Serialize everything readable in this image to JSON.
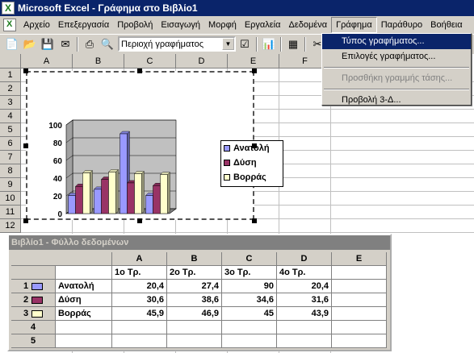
{
  "title_bar": {
    "text": "Microsoft Excel - Γράφημα στο Βιβλίο1"
  },
  "menu": [
    {
      "label": "Αρχείο",
      "open": false
    },
    {
      "label": "Επεξεργασία",
      "open": false
    },
    {
      "label": "Προβολή",
      "open": false
    },
    {
      "label": "Εισαγωγή",
      "open": false
    },
    {
      "label": "Μορφή",
      "open": false
    },
    {
      "label": "Εργαλεία",
      "open": false
    },
    {
      "label": "Δεδομένα",
      "open": false
    },
    {
      "label": "Γράφημα",
      "open": true
    },
    {
      "label": "Παράθυρο",
      "open": false
    },
    {
      "label": "Βοήθεια",
      "open": false
    }
  ],
  "toolbar": {
    "chart_object": "Περιοχή γραφήματος"
  },
  "dropdown": [
    {
      "label": "Τύπος γραφήματος...",
      "state": "selected"
    },
    {
      "label": "Επιλογές γραφήματος...",
      "state": "normal"
    },
    {
      "label": "Προσθήκη γραμμής τάσης...",
      "state": "disabled"
    },
    {
      "label": "Προβολή 3-Δ...",
      "state": "normal"
    }
  ],
  "sheet": {
    "columns": [
      "A",
      "B",
      "C",
      "D",
      "E",
      "F"
    ],
    "rows": [
      "1",
      "2",
      "3",
      "4",
      "5",
      "6",
      "7",
      "8",
      "9",
      "10",
      "11",
      "12"
    ]
  },
  "datasheet": {
    "title": "Βιβλίο1 - Φύλλο δεδομένων",
    "columns": [
      "A",
      "B",
      "C",
      "D",
      "E"
    ],
    "categories": [
      "1ο Τρ.",
      "2ο Τρ.",
      "3ο Τρ.",
      "4ο Τρ."
    ],
    "rows": [
      {
        "num": "1",
        "name": "Ανατολή",
        "values": [
          "20,4",
          "27,4",
          "90",
          "20,4"
        ]
      },
      {
        "num": "2",
        "name": "Δύση",
        "values": [
          "30,6",
          "38,6",
          "34,6",
          "31,6"
        ]
      },
      {
        "num": "3",
        "name": "Βορράς",
        "values": [
          "45,9",
          "46,9",
          "45",
          "43,9"
        ]
      },
      {
        "num": "4",
        "name": "",
        "values": [
          "",
          "",
          "",
          ""
        ]
      },
      {
        "num": "5",
        "name": "",
        "values": [
          "",
          "",
          "",
          ""
        ]
      }
    ]
  },
  "chart_data": {
    "type": "bar",
    "categories": [
      "1ο Τρ.",
      "2ο Τρ.",
      "3ο Τρ.",
      "4ο Τρ."
    ],
    "series": [
      {
        "name": "Ανατολή",
        "values": [
          20.4,
          27.4,
          90,
          20.4
        ],
        "color": "#9999ff"
      },
      {
        "name": "Δύση",
        "values": [
          30.6,
          38.6,
          34.6,
          31.6
        ],
        "color": "#993366"
      },
      {
        "name": "Βορράς",
        "values": [
          45.9,
          46.9,
          45,
          43.9
        ],
        "color": "#ffffcc"
      }
    ],
    "ylim": [
      0,
      100
    ],
    "yticks": [
      0,
      20,
      40,
      60,
      80,
      100
    ],
    "legend": "right",
    "plot_bg": "#c0c0c0",
    "grid": true,
    "three_d": true
  }
}
